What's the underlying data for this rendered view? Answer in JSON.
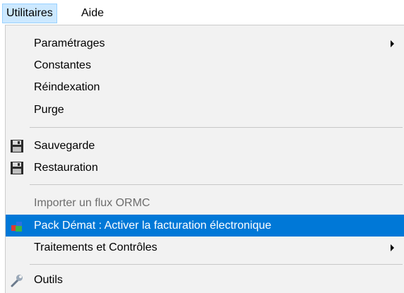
{
  "menubar": {
    "items": [
      {
        "label": "Utilitaires"
      },
      {
        "label": "Aide"
      }
    ]
  },
  "menu": {
    "items": [
      {
        "label": "Paramétrages",
        "submenu": true
      },
      {
        "label": "Constantes"
      },
      {
        "label": "Réindexation"
      },
      {
        "label": "Purge"
      },
      {
        "label": "Sauvegarde",
        "icon": "floppy-disk-icon"
      },
      {
        "label": "Restauration",
        "icon": "floppy-disk-icon"
      },
      {
        "label": "Importer un flux ORMC",
        "disabled": true
      },
      {
        "label": "Pack Démat : Activer la facturation électronique",
        "icon": "pack-demat-icon",
        "highlighted": true
      },
      {
        "label": "Traitements et Contrôles",
        "submenu": true
      },
      {
        "label": "Outils",
        "icon": "wrench-icon"
      }
    ]
  },
  "colors": {
    "highlight": "#0078d7",
    "menubar_active": "#cce8ff",
    "menu_background": "#f2f2f2",
    "disabled_text": "#6d6d6d"
  }
}
